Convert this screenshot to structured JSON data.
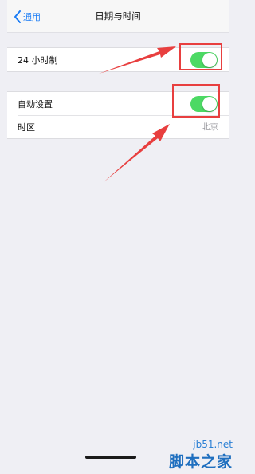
{
  "navbar": {
    "back_label": "通用",
    "title": "日期与时间"
  },
  "settings": {
    "group1": {
      "rows": [
        {
          "label": "24 小时制",
          "toggle_on": true
        }
      ]
    },
    "group2": {
      "rows": [
        {
          "label": "自动设置",
          "toggle_on": true
        },
        {
          "label": "时区",
          "value": "北京"
        }
      ]
    }
  },
  "colors": {
    "accent": "#1a7cf5",
    "toggle_on": "#4cd964",
    "annotation": "#e83f3f"
  },
  "watermark": {
    "url": "jb51.net",
    "name": "脚本之家"
  }
}
